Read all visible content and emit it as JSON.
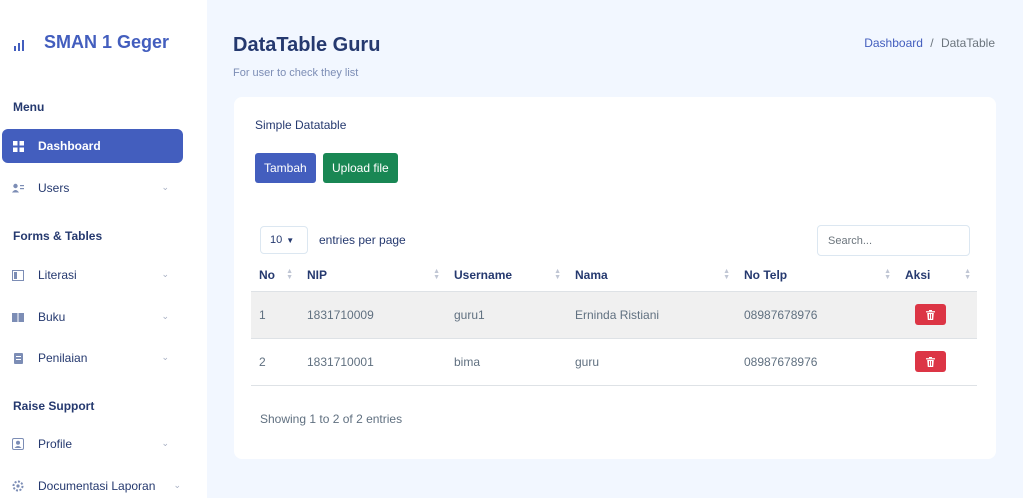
{
  "brand": {
    "title": "SMAN 1 Geger",
    "icon": "bar-chart-icon"
  },
  "sidebar": {
    "sections": [
      {
        "title": "Menu"
      },
      {
        "title": "Forms & Tables"
      },
      {
        "title": "Raise Support"
      }
    ],
    "items": [
      {
        "label": "Dashboard",
        "icon": "grid-icon",
        "active": true
      },
      {
        "label": "Users",
        "icon": "users-icon"
      },
      {
        "label": "Literasi",
        "icon": "book-open-icon"
      },
      {
        "label": "Buku",
        "icon": "book-icon"
      },
      {
        "label": "Penilaian",
        "icon": "document-icon"
      },
      {
        "label": "Profile",
        "icon": "person-badge-icon"
      },
      {
        "label": "Documentasi Laporan",
        "icon": "gear-icon"
      }
    ]
  },
  "header": {
    "title": "DataTable Guru",
    "subtitle": "For user to check they list",
    "breadcrumb": {
      "home": "Dashboard",
      "separator": "/",
      "current": "DataTable"
    }
  },
  "card": {
    "title": "Simple Datatable",
    "buttons": {
      "add": "Tambah",
      "upload": "Upload file"
    },
    "length": {
      "value": "10",
      "label": "entries per page"
    },
    "search": {
      "placeholder": "Search..."
    },
    "columns": [
      "No",
      "NIP",
      "Username",
      "Nama",
      "No Telp",
      "Aksi"
    ],
    "rows": [
      {
        "no": "1",
        "nip": "1831710009",
        "username": "guru1",
        "nama": "Erninda Ristiani",
        "telp": "08987678976"
      },
      {
        "no": "2",
        "nip": "1831710001",
        "username": "bima",
        "nama": "guru",
        "telp": "08987678976"
      }
    ],
    "info": "Showing 1 to 2 of 2 entries"
  },
  "colors": {
    "primary": "#435ebe",
    "success": "#198754",
    "danger": "#dc3545",
    "background": "#f2f7ff"
  }
}
